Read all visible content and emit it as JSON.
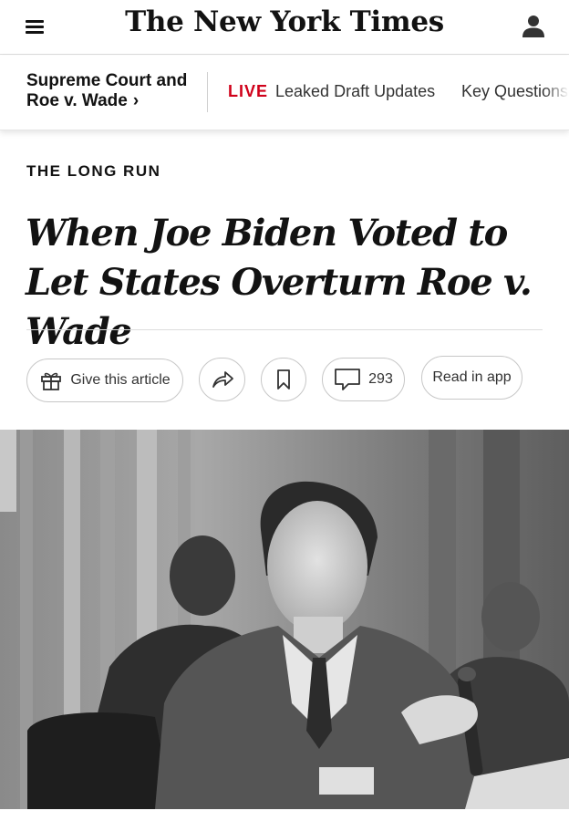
{
  "header": {
    "logo_text": "The New York Times",
    "menu_icon": "hamburger-menu-icon",
    "account_icon": "user-account-icon"
  },
  "section_bar": {
    "section_title": "Supreme Court and Roe v. Wade",
    "section_chevron": "›",
    "live_badge": "LIVE",
    "live_text": "Leaked Draft Updates",
    "next_link": "Key Questions",
    "accent_color": "#d0021b"
  },
  "article": {
    "kicker": "THE LONG RUN",
    "headline": "When Joe Biden Voted to Let States Overturn Roe v. Wade"
  },
  "actions": {
    "gift_label": "Give this article",
    "gift_icon": "gift-icon",
    "share_icon": "share-arrow-icon",
    "save_icon": "bookmark-icon",
    "comments_icon": "comment-bubble-icon",
    "comments_count": "293",
    "app_label": "Read in app"
  },
  "photo": {
    "type": "black-and-white news photograph"
  }
}
